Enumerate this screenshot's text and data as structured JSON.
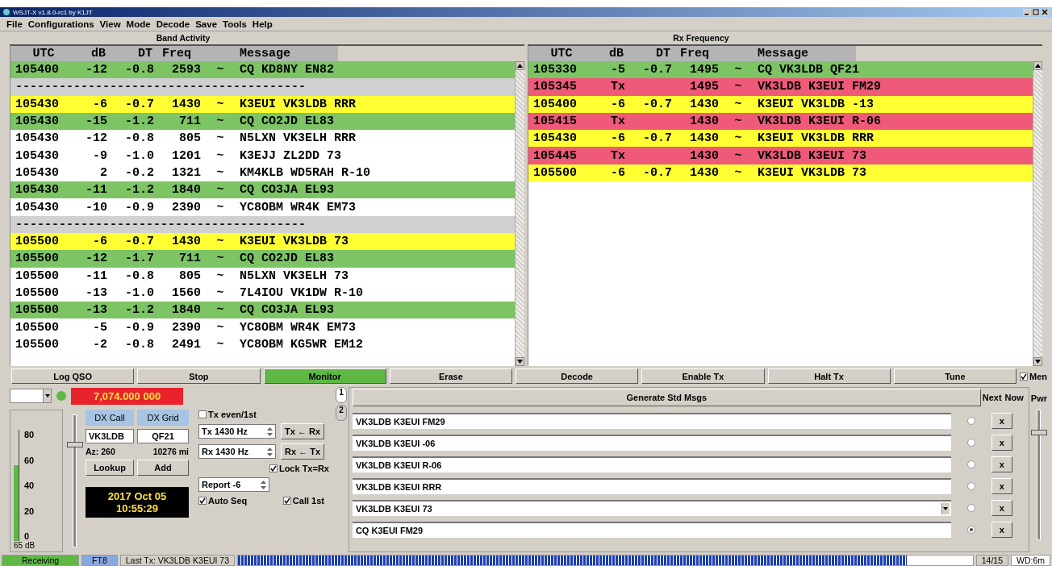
{
  "window": {
    "title": "WSJT-X v1.8.0-rc1 by K1JT"
  },
  "menu": [
    "File",
    "Configurations",
    "View",
    "Mode",
    "Decode",
    "Save",
    "Tools",
    "Help"
  ],
  "band_activity": {
    "title": "Band Activity",
    "columns": [
      "UTC",
      "dB",
      "DT",
      "Freq",
      "Message"
    ],
    "rows": [
      {
        "kind": "decode",
        "color": "#7cc464",
        "utc": "105400",
        "db": "-12",
        "dt": "-0.8",
        "freq": "2593",
        "sync": "~",
        "message": "CQ KD8NY EN82"
      },
      {
        "kind": "separator",
        "text": "----------------------------------------"
      },
      {
        "kind": "decode",
        "color": "#ffff33",
        "utc": "105430",
        "db": "-6",
        "dt": "-0.7",
        "freq": "1430",
        "sync": "~",
        "message": "K3EUI VK3LDB RRR"
      },
      {
        "kind": "decode",
        "color": "#7cc464",
        "utc": "105430",
        "db": "-15",
        "dt": "-1.2",
        "freq": "711",
        "sync": "~",
        "message": "CQ CO2JD EL83"
      },
      {
        "kind": "decode",
        "color": "#ffffff",
        "utc": "105430",
        "db": "-12",
        "dt": "-0.8",
        "freq": "805",
        "sync": "~",
        "message": "N5LXN VK3ELH RRR"
      },
      {
        "kind": "decode",
        "color": "#ffffff",
        "utc": "105430",
        "db": "-9",
        "dt": "-1.0",
        "freq": "1201",
        "sync": "~",
        "message": "K3EJJ ZL2DD 73"
      },
      {
        "kind": "decode",
        "color": "#ffffff",
        "utc": "105430",
        "db": "2",
        "dt": "-0.2",
        "freq": "1321",
        "sync": "~",
        "message": "KM4KLB WD5RAH R-10"
      },
      {
        "kind": "decode",
        "color": "#7cc464",
        "utc": "105430",
        "db": "-11",
        "dt": "-1.2",
        "freq": "1840",
        "sync": "~",
        "message": "CQ CO3JA EL93"
      },
      {
        "kind": "decode",
        "color": "#ffffff",
        "utc": "105430",
        "db": "-10",
        "dt": "-0.9",
        "freq": "2390",
        "sync": "~",
        "message": "YC8OBM WR4K EM73"
      },
      {
        "kind": "separator",
        "text": "----------------------------------------"
      },
      {
        "kind": "decode",
        "color": "#ffff33",
        "utc": "105500",
        "db": "-6",
        "dt": "-0.7",
        "freq": "1430",
        "sync": "~",
        "message": "K3EUI VK3LDB 73"
      },
      {
        "kind": "decode",
        "color": "#7cc464",
        "utc": "105500",
        "db": "-12",
        "dt": "-1.7",
        "freq": "711",
        "sync": "~",
        "message": "CQ CO2JD EL83"
      },
      {
        "kind": "decode",
        "color": "#ffffff",
        "utc": "105500",
        "db": "-11",
        "dt": "-0.8",
        "freq": "805",
        "sync": "~",
        "message": "N5LXN VK3ELH 73"
      },
      {
        "kind": "decode",
        "color": "#ffffff",
        "utc": "105500",
        "db": "-13",
        "dt": "-1.0",
        "freq": "1560",
        "sync": "~",
        "message": "7L4IOU VK1DW R-10"
      },
      {
        "kind": "decode",
        "color": "#7cc464",
        "utc": "105500",
        "db": "-13",
        "dt": "-1.2",
        "freq": "1840",
        "sync": "~",
        "message": "CQ CO3JA EL93"
      },
      {
        "kind": "decode",
        "color": "#ffffff",
        "utc": "105500",
        "db": "-5",
        "dt": "-0.9",
        "freq": "2390",
        "sync": "~",
        "message": "YC8OBM WR4K EM73"
      },
      {
        "kind": "decode",
        "color": "#ffffff",
        "utc": "105500",
        "db": "-2",
        "dt": "-0.8",
        "freq": "2491",
        "sync": "~",
        "message": "YC8OBM KG5WR EM12"
      }
    ]
  },
  "rx_frequency": {
    "title": "Rx Frequency",
    "columns": [
      "UTC",
      "dB",
      "DT",
      "Freq",
      "Message"
    ],
    "rows": [
      {
        "kind": "decode",
        "color": "#7cc464",
        "utc": "105330",
        "db": "-5",
        "dt": "-0.7",
        "freq": "1495",
        "sync": "~",
        "message": "CQ VK3LDB QF21"
      },
      {
        "kind": "decode",
        "color": "#ee5a78",
        "utc": "105345",
        "db": "Tx",
        "freq": "1495",
        "sync": "~",
        "message": "VK3LDB K3EUI FM29"
      },
      {
        "kind": "decode",
        "color": "#ffff33",
        "utc": "105400",
        "db": "-6",
        "dt": "-0.7",
        "freq": "1430",
        "sync": "~",
        "message": "K3EUI VK3LDB -13"
      },
      {
        "kind": "decode",
        "color": "#ee5a78",
        "utc": "105415",
        "db": "Tx",
        "freq": "1430",
        "sync": "~",
        "message": "VK3LDB K3EUI R-06"
      },
      {
        "kind": "decode",
        "color": "#ffff33",
        "utc": "105430",
        "db": "-6",
        "dt": "-0.7",
        "freq": "1430",
        "sync": "~",
        "message": "K3EUI VK3LDB RRR"
      },
      {
        "kind": "decode",
        "color": "#ee5a78",
        "utc": "105445",
        "db": "Tx",
        "freq": "1430",
        "sync": "~",
        "message": "VK3LDB K3EUI 73"
      },
      {
        "kind": "decode",
        "color": "#ffff33",
        "utc": "105500",
        "db": "-6",
        "dt": "-0.7",
        "freq": "1430",
        "sync": "~",
        "message": "K3EUI VK3LDB 73"
      }
    ]
  },
  "buttons": [
    {
      "label": "Log QSO",
      "on": false
    },
    {
      "label": "Stop",
      "on": false
    },
    {
      "label": "Monitor",
      "on": true
    },
    {
      "label": "Erase",
      "on": false
    },
    {
      "label": "Decode",
      "on": false
    },
    {
      "label": "Enable Tx",
      "on": false
    },
    {
      "label": "Halt Tx",
      "on": false
    },
    {
      "label": "Tune",
      "on": false
    }
  ],
  "menus_checkbox": {
    "label": "Men",
    "checked": true
  },
  "frequency": "7,074.000 000",
  "meter": {
    "scale": [
      "80",
      "60",
      "40",
      "20",
      "0"
    ],
    "level": 0.68,
    "reading": "65 dB"
  },
  "rx_slider": {
    "level": 0.8
  },
  "dx": {
    "call_label": "DX Call",
    "grid_label": "DX Grid",
    "call": "VK3LDB",
    "grid": "QF21",
    "azimuth": "Az: 260",
    "distance": "10276 mi",
    "lookup": "Lookup",
    "add": "Add"
  },
  "clock": {
    "date": "2017 Oct 05",
    "time": "10:55:29"
  },
  "tx_controls": {
    "tx_even": {
      "label": "Tx even/1st",
      "checked": false
    },
    "tx_freq": "Tx 1430 Hz",
    "rx_freq": "Rx 1430 Hz",
    "tx_from_rx": "Tx ← Rx",
    "rx_from_tx": "Rx ← Tx",
    "lock": {
      "label": "Lock Tx=Rx",
      "checked": true
    },
    "report": "Report -6",
    "auto_seq": {
      "label": "Auto Seq",
      "checked": true
    },
    "call_first": {
      "label": "Call 1st",
      "checked": true
    }
  },
  "tabs": [
    {
      "label": "1",
      "selected": true
    },
    {
      "label": "2",
      "selected": false
    }
  ],
  "generate": "Generate Std Msgs",
  "next_label": "Next",
  "now_label": "Now",
  "pwr_label": "Pwr",
  "messages": [
    {
      "text": "VK3LDB K3EUI FM29",
      "next": false,
      "now": "x"
    },
    {
      "text": "VK3LDB K3EUI -06",
      "next": false,
      "now": "x"
    },
    {
      "text": "VK3LDB K3EUI R-06",
      "next": false,
      "now": "x"
    },
    {
      "text": "VK3LDB K3EUI RRR",
      "next": false,
      "now": "x"
    },
    {
      "text": "VK3LDB K3EUI 73",
      "next": false,
      "now": "x",
      "kind": "combo"
    },
    {
      "text": "CQ K3EUI FM29",
      "next": true,
      "now": "x"
    }
  ],
  "pwr_slider": {
    "level": 0.85
  },
  "status_bar": {
    "state": "Receiving",
    "mode": "FT8",
    "last_tx": "Last Tx: VK3LDB K3EUI 73",
    "progress": {
      "level": 0.91
    },
    "count": "14/15",
    "wd": "WD:6m"
  }
}
